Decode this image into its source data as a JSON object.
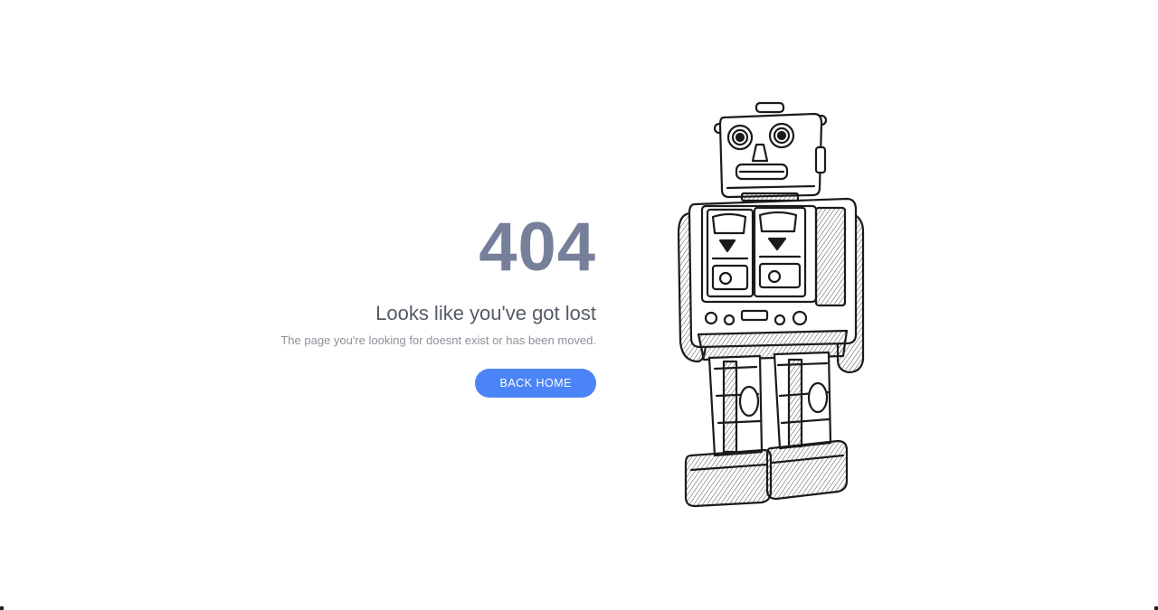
{
  "error": {
    "code": "404",
    "headline": "Looks like you've got lost",
    "message": "The page you're looking for doesnt exist or has been moved.",
    "button_label": "BACK HOME"
  },
  "illustration": {
    "icon": "robot-illustration"
  },
  "colors": {
    "code": "#76809a",
    "headline": "#555b66",
    "message": "#8d9199",
    "button_bg": "#4a84f6",
    "button_text": "#ffffff",
    "background": "#ffffff"
  }
}
